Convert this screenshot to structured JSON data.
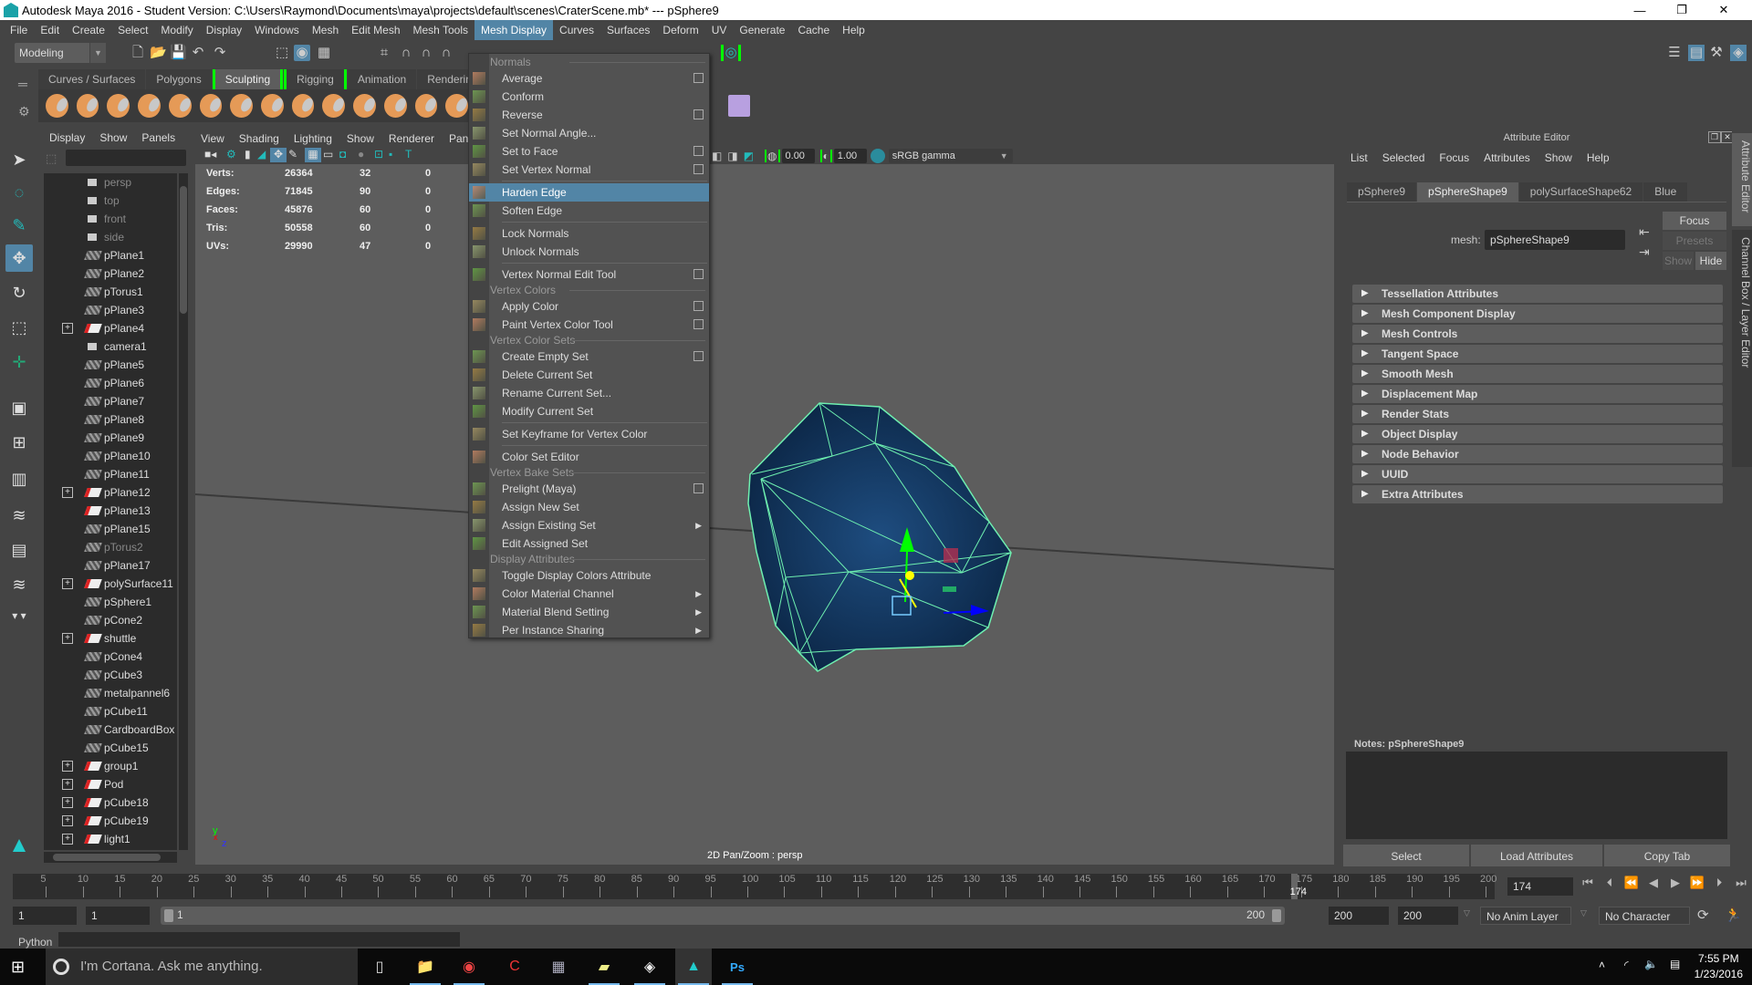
{
  "window": {
    "title": "Autodesk Maya 2016 - Student Version: C:\\Users\\Raymond\\Documents\\maya\\projects\\default\\scenes\\CraterScene.mb*  ---  pSphere9",
    "controls": [
      "—",
      "❐",
      "✕"
    ]
  },
  "menubar": [
    "File",
    "Edit",
    "Create",
    "Select",
    "Modify",
    "Display",
    "Windows",
    "Mesh",
    "Edit Mesh",
    "Mesh Tools",
    "Mesh Display",
    "Curves",
    "Surfaces",
    "Deform",
    "UV",
    "Generate",
    "Cache",
    "Help"
  ],
  "menubar_active": "Mesh Display",
  "toolbar": {
    "mode": "Modeling"
  },
  "shelf": {
    "tabs": [
      "Curves / Surfaces",
      "Polygons",
      "Sculpting",
      "Rigging",
      "Animation",
      "Rendering"
    ],
    "active_tab": "Sculpting"
  },
  "outliner": {
    "menu": [
      "Display",
      "Show",
      "Panels"
    ],
    "items": [
      {
        "label": "persp",
        "type": "cam",
        "dim": true,
        "expand": false
      },
      {
        "label": "top",
        "type": "cam",
        "dim": true,
        "expand": false
      },
      {
        "label": "front",
        "type": "cam",
        "dim": true,
        "expand": false
      },
      {
        "label": "side",
        "type": "cam",
        "dim": true,
        "expand": false
      },
      {
        "label": "pPlane1",
        "type": "mesh",
        "dim": false,
        "expand": false
      },
      {
        "label": "pPlane2",
        "type": "mesh",
        "dim": false,
        "expand": false
      },
      {
        "label": "pTorus1",
        "type": "mesh",
        "dim": false,
        "expand": false
      },
      {
        "label": "pPlane3",
        "type": "mesh",
        "dim": false,
        "expand": false
      },
      {
        "label": "pPlane4",
        "type": "grp",
        "dim": false,
        "expand": true
      },
      {
        "label": "camera1",
        "type": "cam",
        "dim": false,
        "expand": false
      },
      {
        "label": "pPlane5",
        "type": "mesh",
        "dim": false,
        "expand": false
      },
      {
        "label": "pPlane6",
        "type": "mesh",
        "dim": false,
        "expand": false
      },
      {
        "label": "pPlane7",
        "type": "mesh",
        "dim": false,
        "expand": false
      },
      {
        "label": "pPlane8",
        "type": "mesh",
        "dim": false,
        "expand": false
      },
      {
        "label": "pPlane9",
        "type": "mesh",
        "dim": false,
        "expand": false
      },
      {
        "label": "pPlane10",
        "type": "mesh",
        "dim": false,
        "expand": false
      },
      {
        "label": "pPlane11",
        "type": "mesh",
        "dim": false,
        "expand": false
      },
      {
        "label": "pPlane12",
        "type": "grp",
        "dim": false,
        "expand": true
      },
      {
        "label": "pPlane13",
        "type": "grp",
        "dim": false,
        "expand": false
      },
      {
        "label": "pPlane15",
        "type": "mesh",
        "dim": false,
        "expand": false
      },
      {
        "label": "pTorus2",
        "type": "mesh",
        "dim": true,
        "expand": false
      },
      {
        "label": "pPlane17",
        "type": "mesh",
        "dim": false,
        "expand": false
      },
      {
        "label": "polySurface11",
        "type": "grp",
        "dim": false,
        "expand": true
      },
      {
        "label": "pSphere1",
        "type": "mesh",
        "dim": false,
        "expand": false
      },
      {
        "label": "pCone2",
        "type": "mesh",
        "dim": false,
        "expand": false
      },
      {
        "label": "shuttle",
        "type": "grp",
        "dim": false,
        "expand": true
      },
      {
        "label": "pCone4",
        "type": "mesh",
        "dim": false,
        "expand": false
      },
      {
        "label": "pCube3",
        "type": "mesh",
        "dim": false,
        "expand": false
      },
      {
        "label": "metalpannel6",
        "type": "mesh",
        "dim": false,
        "expand": false
      },
      {
        "label": "pCube11",
        "type": "mesh",
        "dim": false,
        "expand": false
      },
      {
        "label": "CardboardBox",
        "type": "mesh",
        "dim": false,
        "expand": false
      },
      {
        "label": "pCube15",
        "type": "mesh",
        "dim": false,
        "expand": false
      },
      {
        "label": "group1",
        "type": "grp",
        "dim": false,
        "expand": true
      },
      {
        "label": "Pod",
        "type": "grp",
        "dim": false,
        "expand": true
      },
      {
        "label": "pCube18",
        "type": "grp",
        "dim": false,
        "expand": true
      },
      {
        "label": "pCube19",
        "type": "grp",
        "dim": false,
        "expand": true
      },
      {
        "label": "light1",
        "type": "grp",
        "dim": false,
        "expand": true
      }
    ]
  },
  "viewport": {
    "menu": [
      "View",
      "Shading",
      "Lighting",
      "Show",
      "Renderer",
      "Panels"
    ],
    "exposure": "0.00",
    "gamma": "1.00",
    "color_space": "sRGB gamma",
    "hud": [
      {
        "label": "Verts:",
        "total": "26364",
        "sel": "32",
        "extra": "0"
      },
      {
        "label": "Edges:",
        "total": "71845",
        "sel": "90",
        "extra": "0"
      },
      {
        "label": "Faces:",
        "total": "45876",
        "sel": "60",
        "extra": "0"
      },
      {
        "label": "Tris:",
        "total": "50558",
        "sel": "60",
        "extra": "0"
      },
      {
        "label": "UVs:",
        "total": "29990",
        "sel": "47",
        "extra": "0"
      }
    ],
    "camera_message": "2D Pan/Zoom : persp",
    "axis": {
      "y": "y",
      "x": "x",
      "z": "z"
    }
  },
  "mesh_display_menu": [
    {
      "kind": "section",
      "label": "Normals"
    },
    {
      "kind": "item",
      "label": "Average",
      "opt": true
    },
    {
      "kind": "item",
      "label": "Conform",
      "opt": false
    },
    {
      "kind": "item",
      "label": "Reverse",
      "opt": true
    },
    {
      "kind": "item",
      "label": "Set Normal Angle...",
      "opt": false
    },
    {
      "kind": "item",
      "label": "Set to Face",
      "opt": true
    },
    {
      "kind": "item",
      "label": "Set Vertex Normal",
      "opt": true
    },
    {
      "kind": "sep"
    },
    {
      "kind": "item",
      "label": "Harden Edge",
      "opt": false,
      "highlight": true
    },
    {
      "kind": "item",
      "label": "Soften Edge",
      "opt": false
    },
    {
      "kind": "sep"
    },
    {
      "kind": "item",
      "label": "Lock Normals",
      "opt": false
    },
    {
      "kind": "item",
      "label": "Unlock Normals",
      "opt": false
    },
    {
      "kind": "sep"
    },
    {
      "kind": "item",
      "label": "Vertex Normal Edit Tool",
      "opt": true
    },
    {
      "kind": "section",
      "label": "Vertex Colors"
    },
    {
      "kind": "item",
      "label": "Apply Color",
      "opt": true
    },
    {
      "kind": "item",
      "label": "Paint Vertex Color Tool",
      "opt": true
    },
    {
      "kind": "section",
      "label": "Vertex Color Sets"
    },
    {
      "kind": "item",
      "label": "Create Empty Set",
      "opt": true
    },
    {
      "kind": "item",
      "label": "Delete Current Set",
      "opt": false
    },
    {
      "kind": "item",
      "label": "Rename Current Set...",
      "opt": false
    },
    {
      "kind": "item",
      "label": "Modify Current Set",
      "opt": false
    },
    {
      "kind": "sep"
    },
    {
      "kind": "item",
      "label": "Set Keyframe for Vertex Color",
      "opt": false
    },
    {
      "kind": "sep"
    },
    {
      "kind": "item",
      "label": "Color Set Editor",
      "opt": false
    },
    {
      "kind": "section",
      "label": "Vertex Bake Sets"
    },
    {
      "kind": "item",
      "label": "Prelight (Maya)",
      "opt": true
    },
    {
      "kind": "item",
      "label": "Assign New Set",
      "opt": false
    },
    {
      "kind": "item",
      "label": "Assign Existing Set",
      "opt": false,
      "submenu": true
    },
    {
      "kind": "item",
      "label": "Edit Assigned Set",
      "opt": false
    },
    {
      "kind": "section",
      "label": "Display Attributes"
    },
    {
      "kind": "item",
      "label": "Toggle Display Colors Attribute",
      "opt": false
    },
    {
      "kind": "item",
      "label": "Color Material Channel",
      "opt": false,
      "submenu": true
    },
    {
      "kind": "item",
      "label": "Material Blend Setting",
      "opt": false,
      "submenu": true
    },
    {
      "kind": "item",
      "label": "Per Instance Sharing",
      "opt": false,
      "submenu": true
    }
  ],
  "attribute_editor": {
    "title": "Attribute Editor",
    "menu": [
      "List",
      "Selected",
      "Focus",
      "Attributes",
      "Show",
      "Help"
    ],
    "tabs": [
      "pSphere9",
      "pSphereShape9",
      "polySurfaceShape62",
      "Blue"
    ],
    "active_tab": "pSphereShape9",
    "mesh_label": "mesh:",
    "mesh_value": "pSphereShape9",
    "focus": "Focus",
    "presets": "Presets",
    "show": "Show",
    "hide": "Hide",
    "sections": [
      "Tessellation Attributes",
      "Mesh Component Display",
      "Mesh Controls",
      "Tangent Space",
      "Smooth Mesh",
      "Displacement Map",
      "Render Stats",
      "Object Display",
      "Node Behavior",
      "UUID",
      "Extra Attributes"
    ],
    "notes_label": "Notes:  pSphereShape9",
    "buttons": [
      "Select",
      "Load Attributes",
      "Copy Tab"
    ]
  },
  "side_tabs": [
    "Attribute Editor",
    "Channel Box / Layer Editor"
  ],
  "timeline": {
    "ticks": [
      5,
      10,
      15,
      20,
      25,
      30,
      35,
      40,
      45,
      50,
      55,
      60,
      65,
      70,
      75,
      80,
      85,
      90,
      95,
      100,
      105,
      110,
      115,
      120,
      125,
      130,
      135,
      140,
      145,
      150,
      155,
      160,
      165,
      170,
      175,
      180,
      185,
      190,
      195,
      200
    ],
    "range_min": 1,
    "range_max": 200,
    "current_frame": "174",
    "current_field": "174"
  },
  "range": {
    "start": "1",
    "playback_start": "1",
    "slider_start": "1",
    "slider_end": "200",
    "playback_end": "200",
    "end": "200",
    "anim_layer": "No Anim Layer",
    "character_set": "No Character Set"
  },
  "cmdline": {
    "label": "Python"
  },
  "taskbar": {
    "cortana": "I'm Cortana. Ask me anything.",
    "time": "7:55 PM",
    "date": "1/23/2016"
  }
}
